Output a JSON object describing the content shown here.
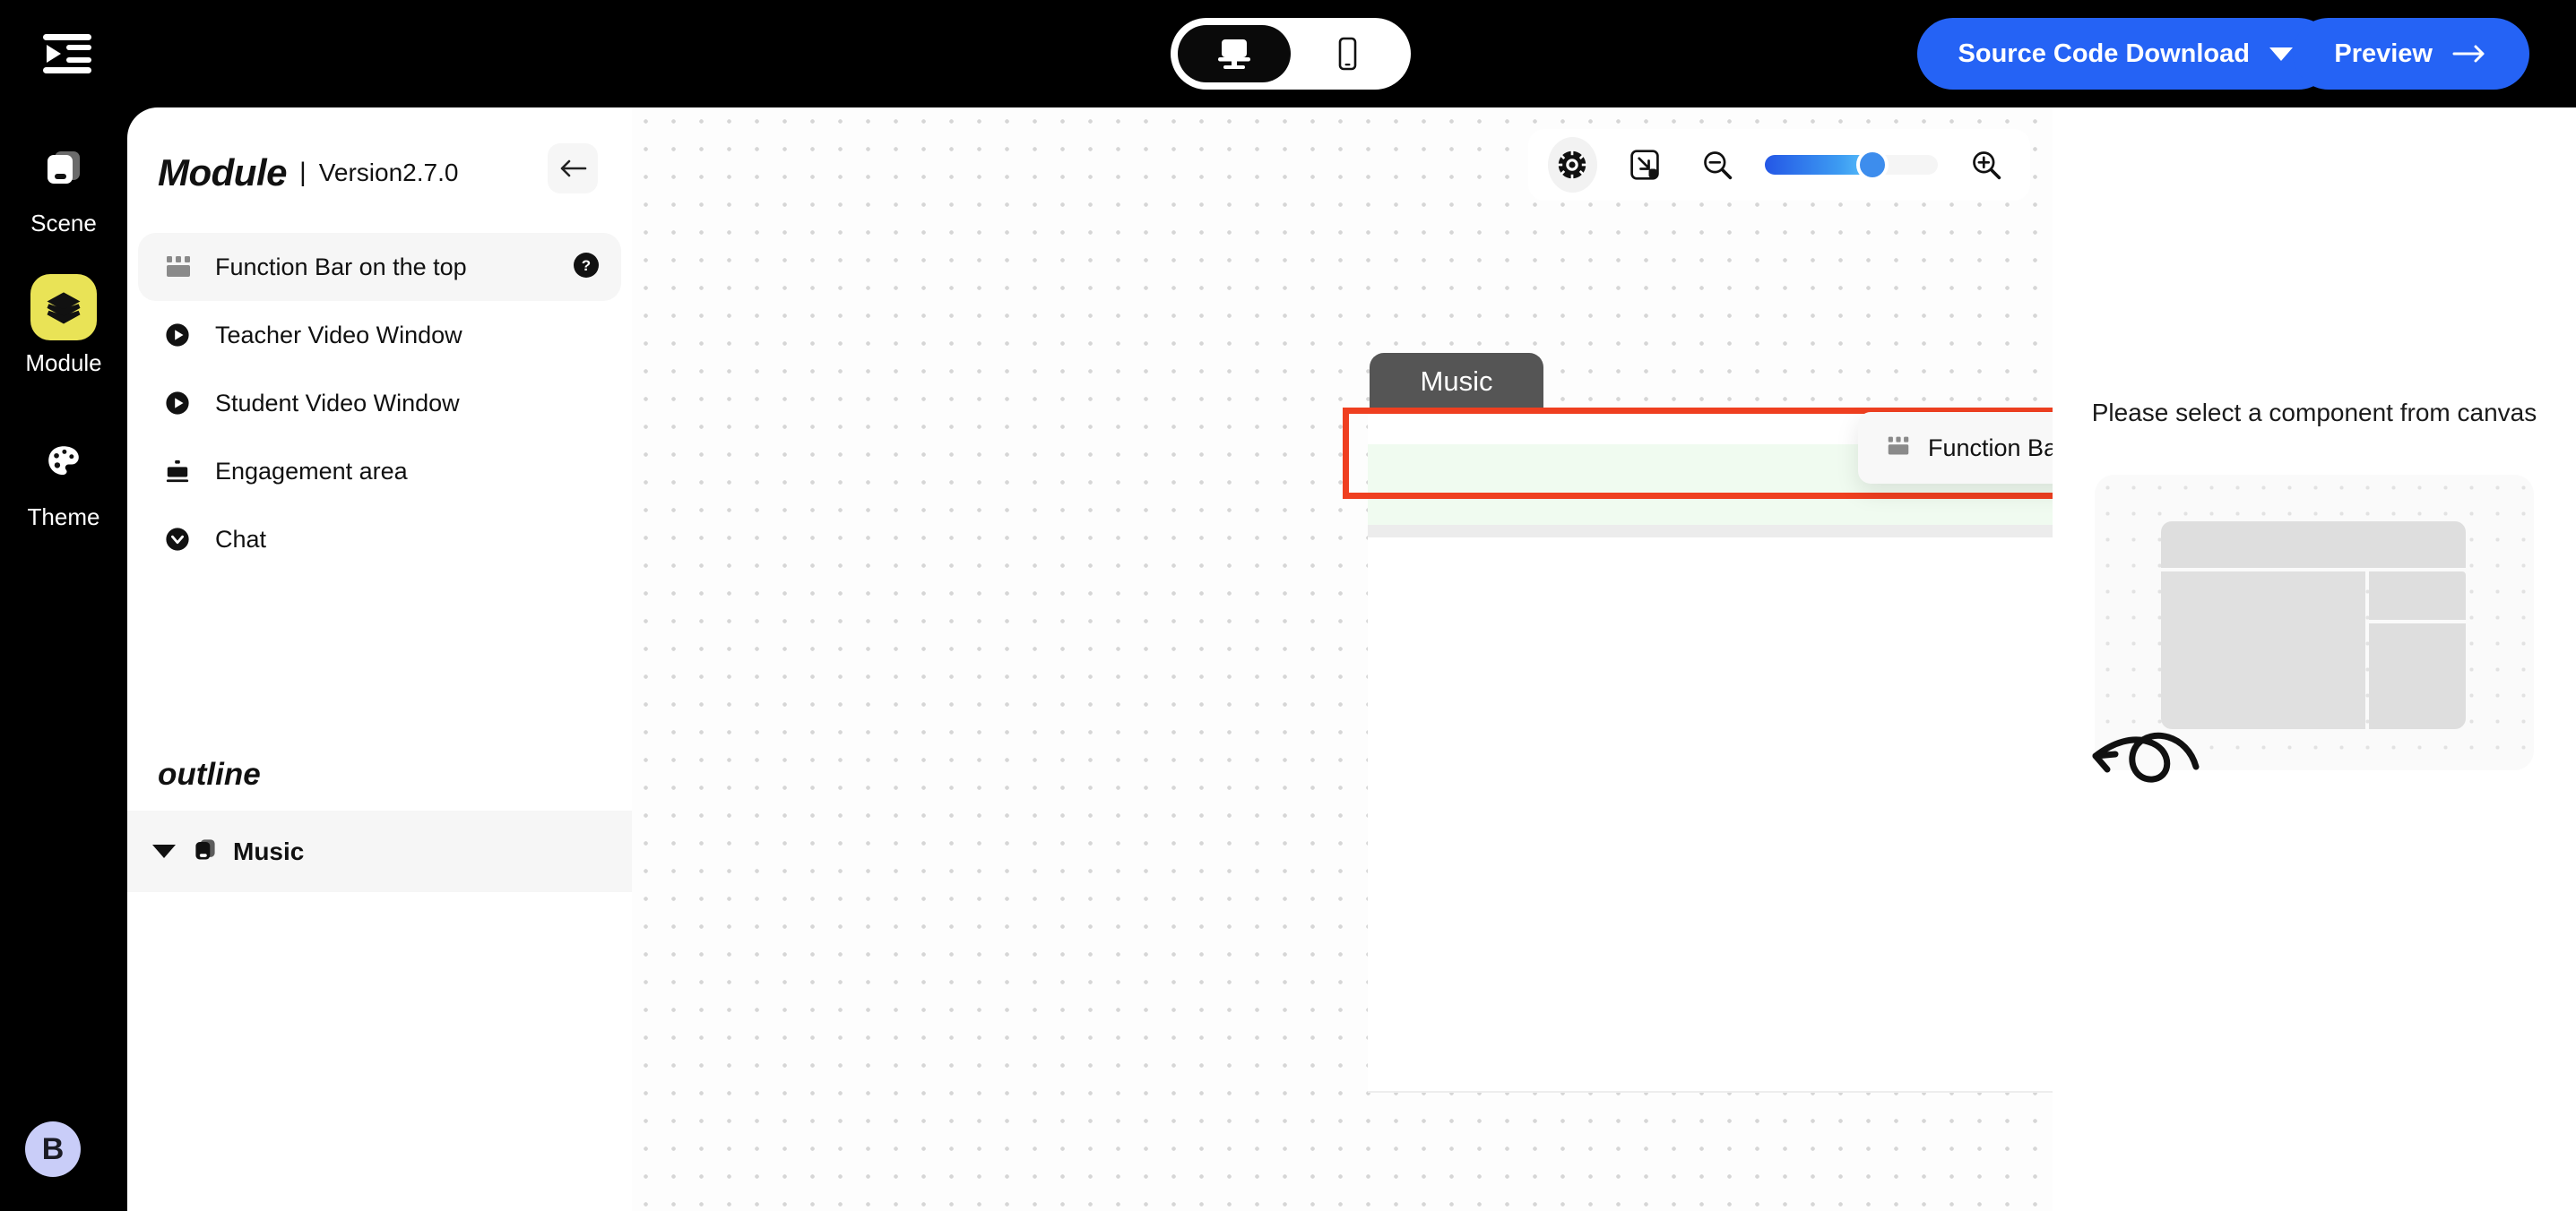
{
  "topbar": {
    "collapse_icon": "collapse-sidebar-icon",
    "device_switch": {
      "options": [
        {
          "id": "desktop",
          "icon": "monitor-icon",
          "active": true
        },
        {
          "id": "mobile",
          "icon": "phone-icon",
          "active": false
        }
      ]
    },
    "source_code_label": "Source Code Download",
    "preview_label": "Preview",
    "accent_color": "#2563f5"
  },
  "rail": {
    "items": [
      {
        "label": "Scene",
        "icon": "scene-icon",
        "active": false
      },
      {
        "label": "Module",
        "icon": "layers-icon",
        "active": true
      },
      {
        "label": "Theme",
        "icon": "palette-icon",
        "active": false
      }
    ],
    "highlight_color": "#e9e356",
    "avatar": {
      "initial": "B",
      "bg": "#c9cdf8"
    }
  },
  "panel": {
    "title": "Module",
    "separator": "|",
    "version": "Version2.7.0",
    "back_icon": "arrow-left-icon",
    "modules": [
      {
        "label": "Function Bar on the top",
        "icon": "function-bar-icon",
        "selected": true,
        "help": true
      },
      {
        "label": "Teacher Video Window",
        "icon": "play-circle-icon",
        "selected": false,
        "help": false
      },
      {
        "label": "Student Video Window",
        "icon": "play-circle-icon",
        "selected": false,
        "help": false
      },
      {
        "label": "Engagement area",
        "icon": "engagement-icon",
        "selected": false,
        "help": false
      },
      {
        "label": "Chat",
        "icon": "chat-circle-icon",
        "selected": false,
        "help": false
      }
    ],
    "outline_title": "outline",
    "outline_items": [
      {
        "label": "Music",
        "icon": "scene-icon",
        "expanded": true
      }
    ]
  },
  "canvas": {
    "toolbar": {
      "target_icon": "target-icon",
      "fit_icon": "fit-to-screen-icon",
      "zoom_out_icon": "zoom-out-icon",
      "zoom_in_icon": "zoom-in-icon",
      "zoom_percent": 55
    },
    "scene_tab": "Music",
    "selected_component": {
      "label": "Function Bar on the top",
      "icon": "function-bar-icon",
      "help_icon": "help-circle-icon",
      "selection_color": "#ef3f20",
      "band_color": "#f0fbf0"
    }
  },
  "right_panel": {
    "empty_message": "Please select a component from canvas",
    "placeholder_icon": "layout-placeholder",
    "arrow_icon": "curly-arrow-icon"
  }
}
